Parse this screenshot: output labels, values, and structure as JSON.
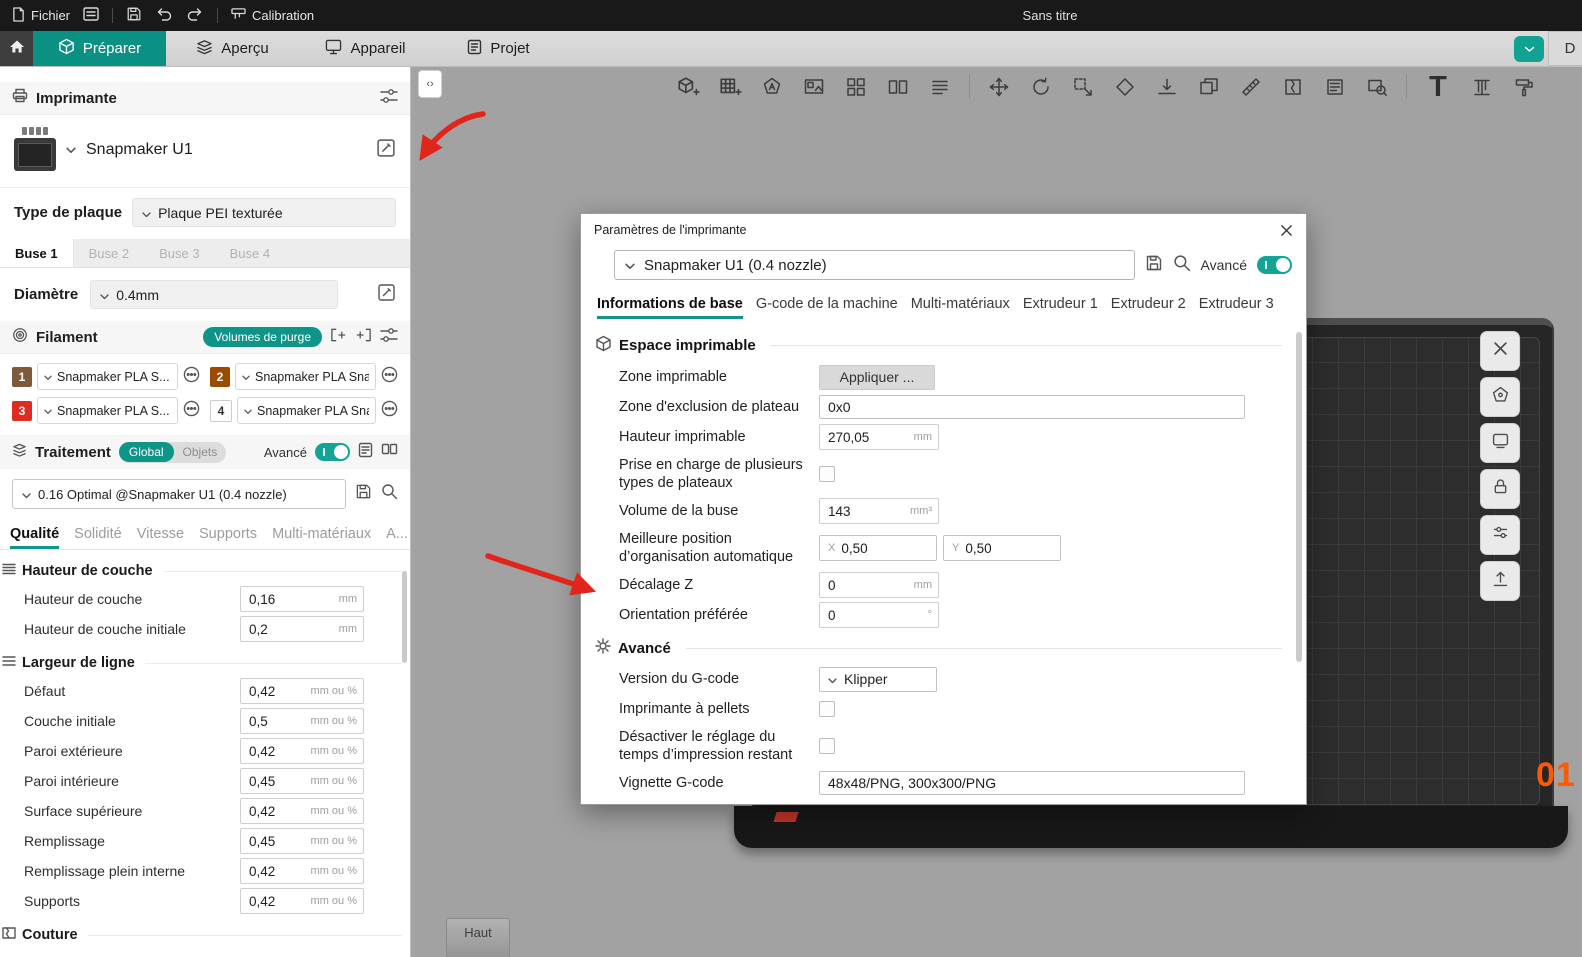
{
  "colors": {
    "accent": "#0f9488",
    "nav_active": "#0b9183",
    "topbar_bg": "#191919",
    "annotation_red": "#e1251b",
    "bed_number_orange": "#ff5a00"
  },
  "icons": {
    "text_tool_glyph": "T",
    "collapse_glyphs": "‹›"
  },
  "topbar": {
    "file_menu": "Fichier",
    "calibration": "Calibration",
    "title": "Sans titre"
  },
  "nav": {
    "tabs": [
      "Préparer",
      "Aperçu",
      "Appareil",
      "Projet"
    ],
    "user_badge": "D"
  },
  "sidebar": {
    "printer": {
      "header": "Imprimante",
      "name": "Snapmaker U1",
      "plate_type_label": "Type de plaque",
      "plate_type_value": "Plaque PEI texturée",
      "nozzle_tabs": [
        "Buse 1",
        "Buse 2",
        "Buse 3",
        "Buse 4"
      ],
      "diameter_label": "Diamètre",
      "diameter_value": "0.4mm"
    },
    "filament": {
      "header": "Filament",
      "purge_button": "Volumes de purge",
      "items": [
        {
          "index": "1",
          "color": "#7e5a3c",
          "name": "Snapmaker PLA S..."
        },
        {
          "index": "2",
          "color": "#9c4a00",
          "name": "Snapmaker PLA Sna..."
        },
        {
          "index": "3",
          "color": "#e02b20",
          "name": "Snapmaker PLA S..."
        },
        {
          "index": "4",
          "color": "#ffffff",
          "name": "Snapmaker PLA Sna..."
        }
      ]
    },
    "process": {
      "header": "Traitement",
      "scope_global": "Global",
      "scope_objects": "Objets",
      "advanced_label": "Avancé",
      "preset": "0.16 Optimal @Snapmaker U1 (0.4 nozzle)",
      "tabs": [
        "Qualité",
        "Solidité",
        "Vitesse",
        "Supports",
        "Multi-matériaux",
        "A..."
      ],
      "sections": [
        {
          "title": "Hauteur de couche",
          "rows": [
            {
              "label": "Hauteur de couche",
              "value": "0,16",
              "unit": "mm"
            },
            {
              "label": "Hauteur de couche initiale",
              "value": "0,2",
              "unit": "mm"
            }
          ]
        },
        {
          "title": "Largeur de ligne",
          "rows": [
            {
              "label": "Défaut",
              "value": "0,42",
              "unit": "mm ou %"
            },
            {
              "label": "Couche initiale",
              "value": "0,5",
              "unit": "mm ou %"
            },
            {
              "label": "Paroi extérieure",
              "value": "0,42",
              "unit": "mm ou %"
            },
            {
              "label": "Paroi intérieure",
              "value": "0,45",
              "unit": "mm ou %"
            },
            {
              "label": "Surface supérieure",
              "value": "0,42",
              "unit": "mm ou %"
            },
            {
              "label": "Remplissage",
              "value": "0,45",
              "unit": "mm ou %"
            },
            {
              "label": "Remplissage plein interne",
              "value": "0,42",
              "unit": "mm ou %"
            },
            {
              "label": "Supports",
              "value": "0,42",
              "unit": "mm ou %"
            }
          ]
        },
        {
          "title": "Couture",
          "rows": []
        }
      ]
    }
  },
  "dialog": {
    "title": "Paramètres de l'imprimante",
    "preset": "Snapmaker U1 (0.4 nozzle)",
    "advanced_label": "Avancé",
    "tabs": [
      "Informations de base",
      "G-code de la machine",
      "Multi-matériaux",
      "Extrudeur 1",
      "Extrudeur 2",
      "Extrudeur 3"
    ],
    "printable_space": {
      "title": "Espace imprimable",
      "printable_area_label": "Zone imprimable",
      "printable_area_button": "Appliquer ...",
      "exclusion_label": "Zone d'exclusion de plateau",
      "exclusion_value": "0x0",
      "printable_height_label": "Hauteur imprimable",
      "printable_height_value": "270,05",
      "printable_height_unit": "mm",
      "multi_bed_label": "Prise en charge de plusieurs types de plateaux",
      "nozzle_volume_label": "Volume de la buse",
      "nozzle_volume_value": "143",
      "nozzle_volume_unit": "mm³",
      "best_position_label": "Meilleure position d’organisation automatique",
      "best_x_prefix": "X",
      "best_x_value": "0,50",
      "best_y_prefix": "Y",
      "best_y_value": "0,50",
      "z_offset_label": "Décalage Z",
      "z_offset_value": "0",
      "z_offset_unit": "mm",
      "orientation_label": "Orientation préférée",
      "orientation_value": "0",
      "orientation_unit": "°"
    },
    "advanced": {
      "title": "Avancé",
      "gcode_flavor_label": "Version du G-code",
      "gcode_flavor_value": "Klipper",
      "pellet_label": "Imprimante à pellets",
      "disable_m73_label": "Désactiver le réglage du temps d’impression restant",
      "thumbnail_label": "Vignette G-code",
      "thumbnail_value": "48x48/PNG, 300x300/PNG"
    }
  },
  "viewport": {
    "haut_label": "Haut",
    "bed_number": "01"
  }
}
